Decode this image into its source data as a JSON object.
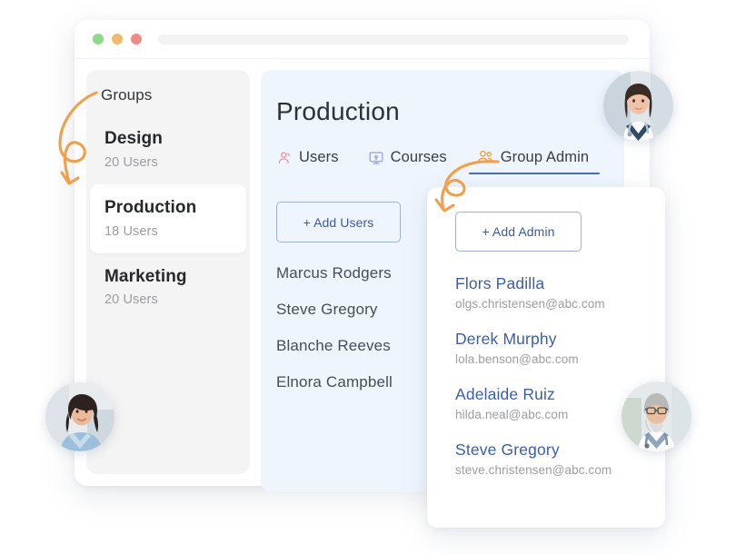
{
  "window": {
    "dots": [
      {
        "name": "traffic-light-green",
        "color": "#8ed98a"
      },
      {
        "name": "traffic-light-yellow",
        "color": "#f3b96a"
      },
      {
        "name": "traffic-light-red",
        "color": "#f08a84"
      }
    ],
    "address_value": ""
  },
  "sidebar": {
    "title": "Groups",
    "groups": [
      {
        "name": "Design",
        "count": "20 Users",
        "selected": false
      },
      {
        "name": "Production",
        "count": "18 Users",
        "selected": true
      },
      {
        "name": "Marketing",
        "count": "20 Users",
        "selected": false
      }
    ]
  },
  "main": {
    "title": "Production",
    "tabs": [
      {
        "label": "Users",
        "icon": "user-icon",
        "icon_color": "#e8959a",
        "active": false
      },
      {
        "label": "Courses",
        "icon": "monitor-icon",
        "icon_color": "#8ea2e8",
        "active": false
      },
      {
        "label": "Group Admin",
        "icon": "users-group-icon",
        "icon_color": "#f0a04b",
        "active": true
      }
    ],
    "active_tab_underline_color": "#4a6fb5",
    "add_users_label": "+ Add Users",
    "users": [
      "Marcus Rodgers",
      "Steve Gregory",
      "Blanche Reeves",
      "Elnora Campbell"
    ]
  },
  "admin_card": {
    "add_admin_label": "+ Add Admin",
    "admins": [
      {
        "name": "Flors Padilla",
        "email": "olgs.christensen@abc.com"
      },
      {
        "name": "Derek Murphy",
        "email": "lola.benson@abc.com"
      },
      {
        "name": "Adelaide Ruiz",
        "email": "hilda.neal@abc.com"
      },
      {
        "name": "Steve Gregory",
        "email": "steve.christensen@abc.com"
      }
    ]
  },
  "avatars": [
    {
      "name": "avatar-doctor-female",
      "description": "female doctor with dark hair in white coat"
    },
    {
      "name": "avatar-woman-blue-shirt",
      "description": "smiling woman with dark curly hair in light blue shirt"
    },
    {
      "name": "avatar-doctor-male",
      "description": "older male doctor with gray hair, beard and glasses"
    }
  ],
  "annotations": {
    "arrow_color": "#f0a04b",
    "arrows": [
      {
        "name": "arrow-to-groups",
        "description": "curved looping arrow pointing to Groups sidebar"
      },
      {
        "name": "arrow-to-group-admin",
        "description": "curved looping arrow pointing from Group Admin tab to admin card"
      }
    ]
  }
}
